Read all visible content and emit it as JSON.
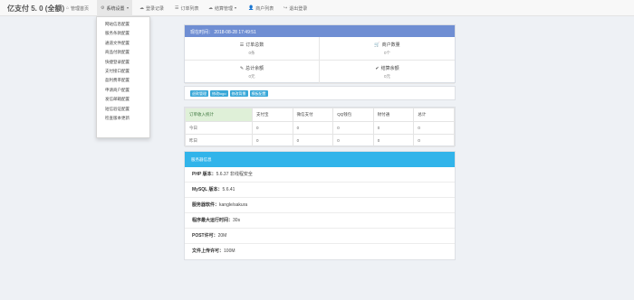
{
  "navbar": {
    "brand": "亿支付 5. 0 (全额)",
    "items": [
      {
        "icon": "home-icon",
        "glyph": "⌂",
        "label": "管理首页"
      },
      {
        "icon": "gear-icon",
        "glyph": "⚙",
        "label": "系统设置"
      },
      {
        "icon": "cloud-icon",
        "glyph": "☁",
        "label": "登录记录"
      },
      {
        "icon": "list-icon",
        "glyph": "☰",
        "label": "订单列表"
      },
      {
        "icon": "cloud-icon",
        "glyph": "☁",
        "label": "结算管理"
      },
      {
        "icon": "user-icon",
        "glyph": "👤",
        "label": "商户列表"
      },
      {
        "icon": "logout-icon",
        "glyph": "↪",
        "label": "退出登录"
      }
    ]
  },
  "dropdown": {
    "items": [
      "网站信息配置",
      "服务条款配置",
      "通道文件配置",
      "商品付款配置",
      "快捷登录配置",
      "支付接口配置",
      "盈利费率配置",
      "申请商户配置",
      "发信邮箱配置",
      "短信验证配置",
      "检查版本更新"
    ]
  },
  "info_panel": {
    "header": "现在时间： 2018-08-28 17:49:51",
    "cells": [
      {
        "icon": "list-icon",
        "glyph": "☰",
        "title": "订单总数",
        "value": "0条"
      },
      {
        "icon": "cart-icon",
        "glyph": "🛒",
        "title": "商户数量",
        "value": "0个"
      },
      {
        "icon": "pen-icon",
        "glyph": "✎",
        "title": "总计余额",
        "value": "0元"
      },
      {
        "icon": "check-icon",
        "glyph": "✔",
        "title": "结算余额",
        "value": "0元"
      }
    ]
  },
  "action_buttons": [
    "退款管理",
    "修改logo",
    "修改背景",
    "模板配置"
  ],
  "stats_table": {
    "headers": [
      "订单收入统计",
      "支付宝",
      "微信支付",
      "QQ钱包",
      "财付通",
      "总计"
    ],
    "rows": [
      [
        "今日",
        "0",
        "0",
        "0",
        "0",
        "0"
      ],
      [
        "昨日",
        "0",
        "0",
        "0",
        "0",
        "0"
      ]
    ]
  },
  "server_panel": {
    "header": "服务器信息",
    "rows": [
      {
        "label": "PHP 版本：",
        "value": "5.6.37 非线程安全"
      },
      {
        "label": "MySQL 版本：",
        "value": "5.6.41"
      },
      {
        "label": "服务器软件：",
        "value": "kangle/sakura"
      },
      {
        "label": "程序最大运行时间：",
        "value": "30s"
      },
      {
        "label": "POST许可：",
        "value": "20M"
      },
      {
        "label": "文件上传许可：",
        "value": "100M"
      }
    ]
  },
  "colors": {
    "info_header": "#6f8ed3",
    "server_header": "#31b4ea",
    "button_tag": "#3aa8d8",
    "table_first_header": "#dff0d8"
  }
}
